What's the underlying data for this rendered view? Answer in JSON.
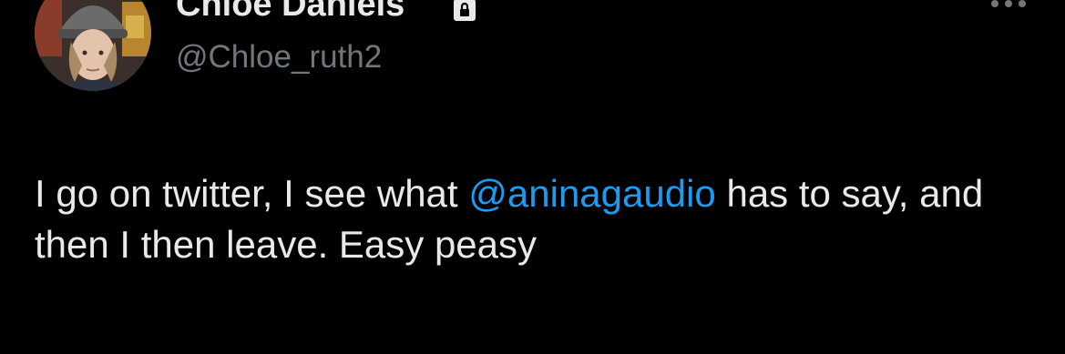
{
  "user": {
    "display_name": "Chloe Daniels",
    "handle": "@Chloe_ruth2",
    "protected_icon": "lock-icon",
    "avatar_icon": "profile-photo"
  },
  "menu": {
    "icon": "more-horizontal-icon"
  },
  "tweet": {
    "text_before_mention": "I go on twitter, I see what ",
    "mention": "@aninagaudio",
    "text_after_mention": " has to say, and then I then leave. Easy peasy"
  },
  "colors": {
    "background": "#000000",
    "primary_text": "#e7e9ea",
    "secondary_text": "#71767b",
    "link": "#1d9bf0"
  }
}
